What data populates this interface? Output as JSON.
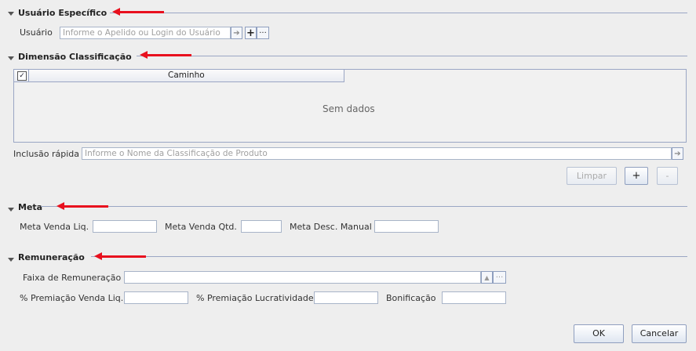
{
  "sections": {
    "usuario": {
      "title": "Usuário Específico",
      "user_label": "Usuário",
      "user_placeholder": "Informe o Apelido ou Login do Usuário"
    },
    "dimensao": {
      "title": "Dimensão Classificação",
      "column_header": "Caminho",
      "empty_text": "Sem dados",
      "quick_label": "Inclusão rápida",
      "quick_placeholder": "Informe o Nome da Classificação de Produto",
      "limpar_label": "Limpar",
      "add_label": "+",
      "remove_label": "-"
    },
    "meta": {
      "title": "Meta",
      "venda_liq_label": "Meta Venda Liq.",
      "venda_qtd_label": "Meta Venda Qtd.",
      "desc_manual_label": "Meta Desc. Manual"
    },
    "remuneracao": {
      "title": "Remuneração",
      "faixa_label": "Faixa de Remuneração",
      "prem_venda_label": "% Premiação Venda Liq.",
      "prem_lucro_label": "% Premiação Lucratividade",
      "bonificacao_label": "Bonificação"
    }
  },
  "footer": {
    "ok_label": "OK",
    "cancel_label": "Cancelar"
  },
  "colors": {
    "annotation_arrow": "#e8101e",
    "section_line": "#9aa6c4"
  }
}
